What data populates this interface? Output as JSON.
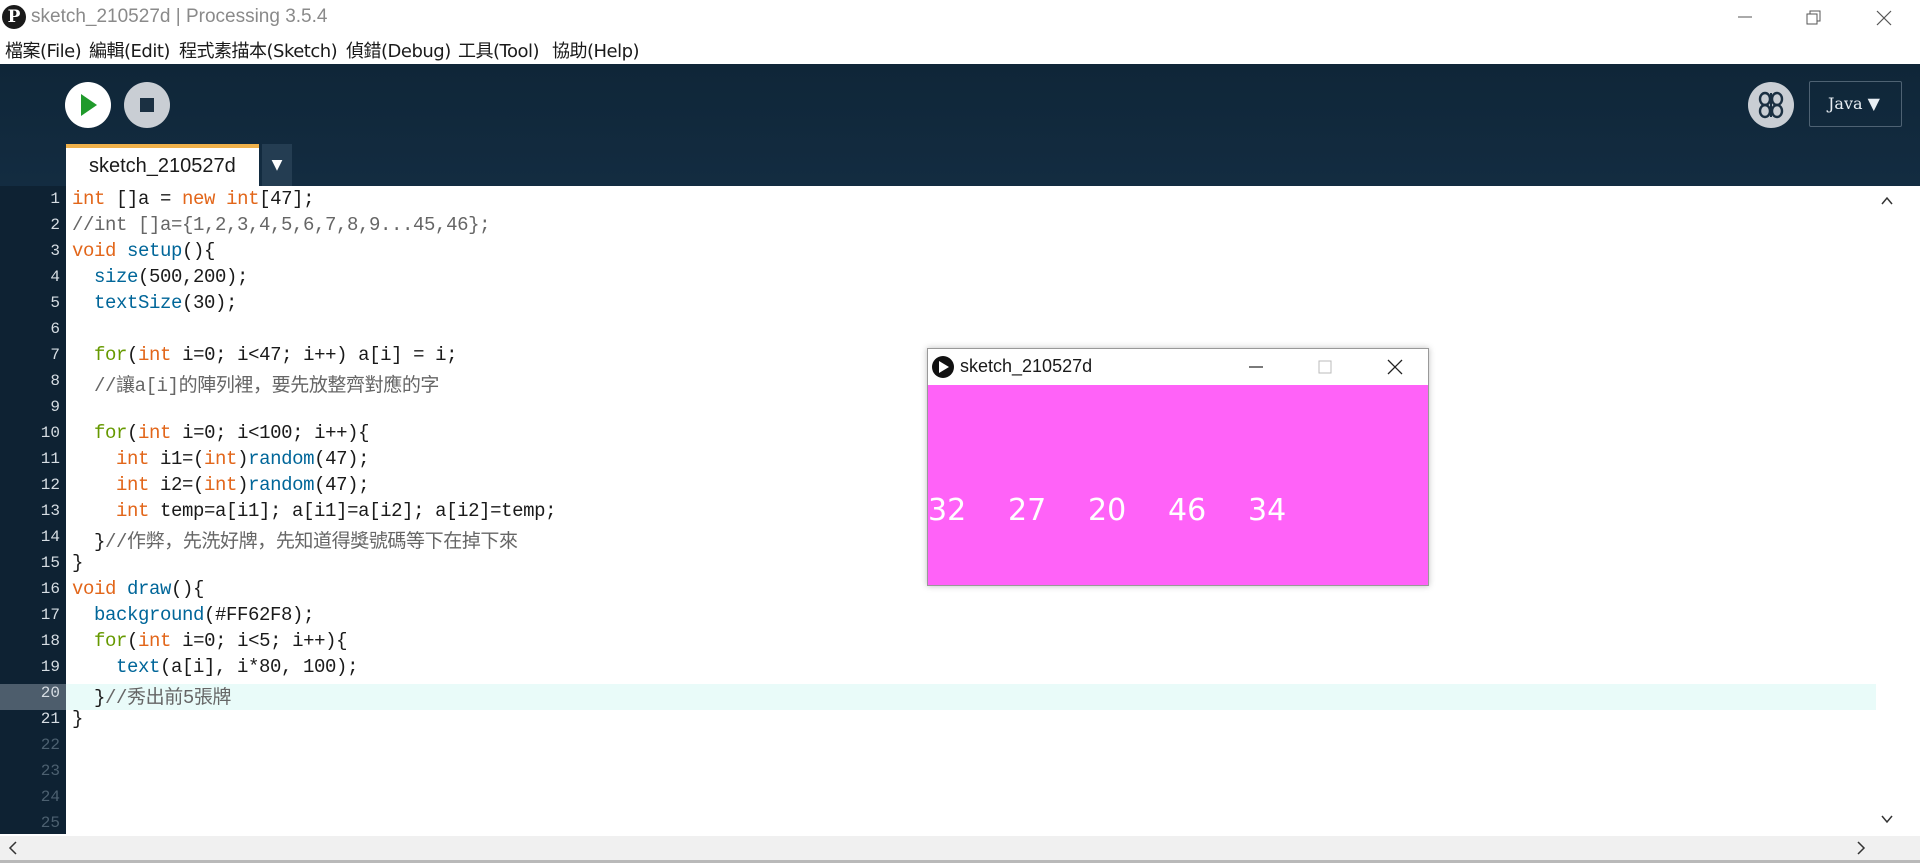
{
  "window": {
    "title": "sketch_210527d | Processing 3.5.4",
    "app_logo": "P"
  },
  "menu": [
    "檔案(File)",
    "編輯(Edit)",
    "程式素描本(Sketch)",
    "偵錯(Debug)",
    "工具(Tool)",
    "協助(Help)"
  ],
  "toolbar": {
    "mode": "Java ▼"
  },
  "tabs": [
    {
      "label": "sketch_210527d"
    }
  ],
  "tab_menu": "▼",
  "editor": {
    "current_line": 20,
    "line_numbers": [
      "1",
      "2",
      "3",
      "4",
      "5",
      "6",
      "7",
      "8",
      "9",
      "10",
      "11",
      "12",
      "13",
      "14",
      "15",
      "16",
      "17",
      "18",
      "19",
      "20",
      "21",
      "22",
      "23",
      "24",
      "25"
    ],
    "lines": [
      [
        {
          "t": "int",
          "c": "kw"
        },
        {
          "t": " []a = "
        },
        {
          "t": "new",
          "c": "kw"
        },
        {
          "t": " "
        },
        {
          "t": "int",
          "c": "kw"
        },
        {
          "t": "[47];"
        }
      ],
      [
        {
          "t": "//int []a={1,2,3,4,5,6,7,8,9...45,46};",
          "c": "cm"
        }
      ],
      [
        {
          "t": "void",
          "c": "kw"
        },
        {
          "t": " "
        },
        {
          "t": "setup",
          "c": "fn"
        },
        {
          "t": "(){"
        }
      ],
      [
        {
          "t": "  "
        },
        {
          "t": "size",
          "c": "fn"
        },
        {
          "t": "(500,200);"
        }
      ],
      [
        {
          "t": "  "
        },
        {
          "t": "textSize",
          "c": "fn"
        },
        {
          "t": "(30);"
        }
      ],
      [
        {
          "t": ""
        }
      ],
      [
        {
          "t": "  "
        },
        {
          "t": "for",
          "c": "fn2"
        },
        {
          "t": "("
        },
        {
          "t": "int",
          "c": "kw"
        },
        {
          "t": " i=0; i<47; i++) a[i] = i;"
        }
      ],
      [
        {
          "t": "  //讓a[i]的陣列裡，要先放整齊對應的字",
          "c": "cm"
        }
      ],
      [
        {
          "t": ""
        }
      ],
      [
        {
          "t": "  "
        },
        {
          "t": "for",
          "c": "fn2"
        },
        {
          "t": "("
        },
        {
          "t": "int",
          "c": "kw"
        },
        {
          "t": " i=0; i<100; i++){"
        }
      ],
      [
        {
          "t": "    "
        },
        {
          "t": "int",
          "c": "kw"
        },
        {
          "t": " i1=("
        },
        {
          "t": "int",
          "c": "kw"
        },
        {
          "t": ")"
        },
        {
          "t": "random",
          "c": "fn"
        },
        {
          "t": "(47);"
        }
      ],
      [
        {
          "t": "    "
        },
        {
          "t": "int",
          "c": "kw"
        },
        {
          "t": " i2=("
        },
        {
          "t": "int",
          "c": "kw"
        },
        {
          "t": ")"
        },
        {
          "t": "random",
          "c": "fn"
        },
        {
          "t": "(47);"
        }
      ],
      [
        {
          "t": "    "
        },
        {
          "t": "int",
          "c": "kw"
        },
        {
          "t": " temp=a[i1]; a[i1]=a[i2]; a[i2]=temp;"
        }
      ],
      [
        {
          "t": "  }"
        },
        {
          "t": "//作弊，先洗好牌，先知道得獎號碼等下在掉下來",
          "c": "cm"
        }
      ],
      [
        {
          "t": "}"
        }
      ],
      [
        {
          "t": "void",
          "c": "kw"
        },
        {
          "t": " "
        },
        {
          "t": "draw",
          "c": "fn"
        },
        {
          "t": "(){"
        }
      ],
      [
        {
          "t": "  "
        },
        {
          "t": "background",
          "c": "fn"
        },
        {
          "t": "(#FF62F8);"
        }
      ],
      [
        {
          "t": "  "
        },
        {
          "t": "for",
          "c": "fn2"
        },
        {
          "t": "("
        },
        {
          "t": "int",
          "c": "kw"
        },
        {
          "t": " i=0; i<5; i++){"
        }
      ],
      [
        {
          "t": "    "
        },
        {
          "t": "text",
          "c": "fn"
        },
        {
          "t": "(a[i], i*80, 100);"
        }
      ],
      [
        {
          "t": "  }"
        },
        {
          "t": "//秀出前5張牌",
          "c": "cm"
        }
      ],
      [
        {
          "t": "}"
        }
      ]
    ]
  },
  "sketch_window": {
    "title": "sketch_210527d",
    "background": "#FF62F8",
    "numbers": [
      "32",
      "27",
      "20",
      "46",
      "34"
    ]
  },
  "colors": {
    "keyword": "#e2661a",
    "function": "#006699",
    "control": "#669900",
    "comment": "#666666",
    "ide_dark": "#0f2638"
  }
}
